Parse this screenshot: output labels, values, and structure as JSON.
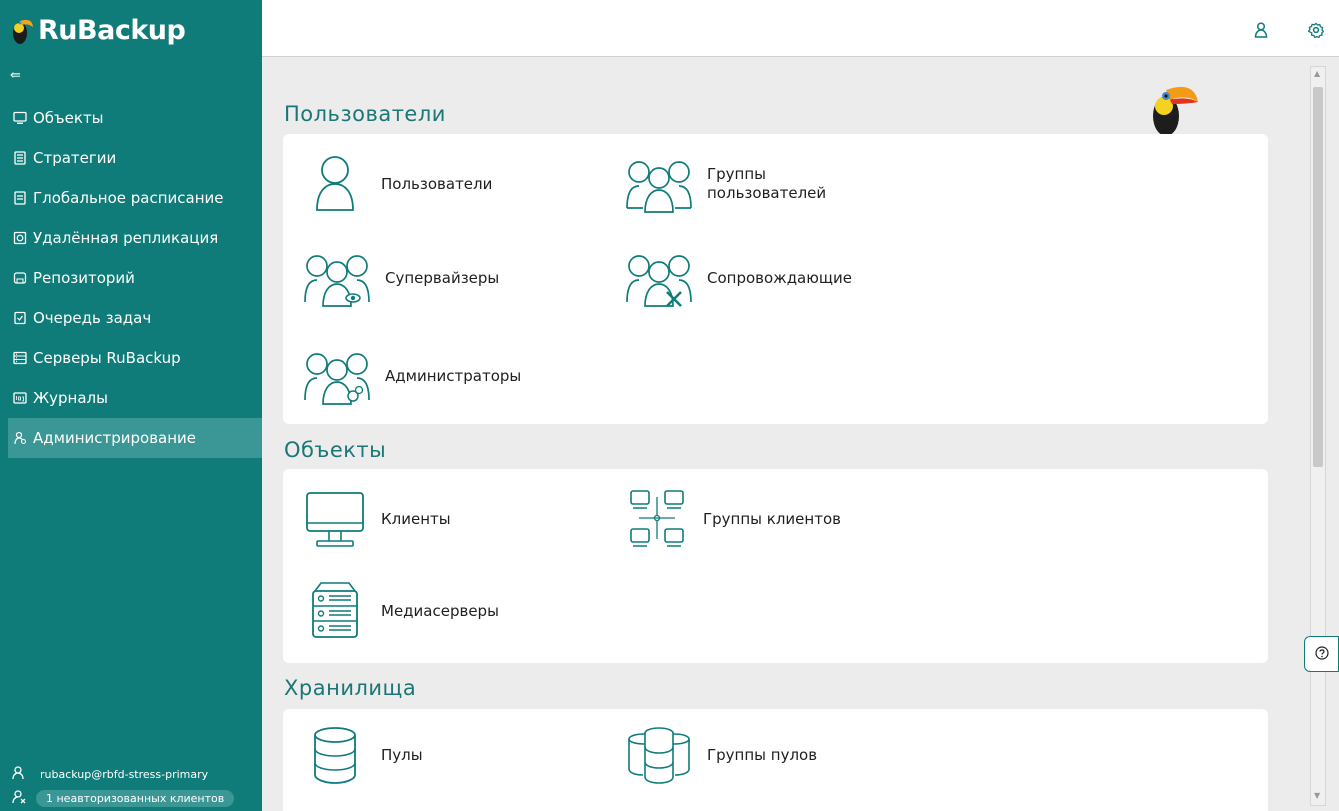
{
  "app": {
    "logo_ru": "Ru",
    "logo_backup": "Backup"
  },
  "sidebar": {
    "collapse_glyph": "⇚",
    "items": [
      {
        "label": "Объекты",
        "icon": "monitor-icon"
      },
      {
        "label": "Стратегии",
        "icon": "strategy-icon"
      },
      {
        "label": "Глобальное расписание",
        "icon": "schedule-icon"
      },
      {
        "label": "Удалённая репликация",
        "icon": "replication-icon"
      },
      {
        "label": "Репозиторий",
        "icon": "repository-icon"
      },
      {
        "label": "Очередь задач",
        "icon": "task-queue-icon"
      },
      {
        "label": "Серверы RuBackup",
        "icon": "servers-icon"
      },
      {
        "label": "Журналы",
        "icon": "log-icon"
      },
      {
        "label": "Администрирование",
        "icon": "admin-icon",
        "active": true
      }
    ],
    "footer": {
      "user": "rubackup@rbfd-stress-primary",
      "unauthorized_clients": "1 неавторизованных клиентов"
    }
  },
  "topbar": {
    "icons": [
      "user-icon",
      "settings-icon"
    ]
  },
  "sections": {
    "users": {
      "title": "Пользователи",
      "tiles": [
        {
          "label": "Пользователи",
          "icon": "user-icon"
        },
        {
          "label_line1": "Группы",
          "label_line2": "пользователей",
          "icon": "user-group-icon"
        },
        {
          "label": "Супервайзеры",
          "icon": "supervisors-icon"
        },
        {
          "label": "Сопровождающие",
          "icon": "maintainers-icon"
        },
        {
          "label": "Администраторы",
          "icon": "administrators-icon"
        }
      ]
    },
    "objects": {
      "title": "Объекты",
      "tiles": [
        {
          "label": "Клиенты",
          "icon": "client-monitor-icon"
        },
        {
          "label": "Группы клиентов",
          "icon": "client-group-icon"
        },
        {
          "label": "Медиасерверы",
          "icon": "media-server-icon"
        }
      ]
    },
    "storage": {
      "title": "Хранилища",
      "tiles": [
        {
          "label": "Пулы",
          "icon": "pool-icon"
        },
        {
          "label": "Группы пулов",
          "icon": "pool-group-icon"
        }
      ]
    }
  },
  "colors": {
    "brand": "#0f7c7a",
    "active_nav": "#3a9795",
    "accent_text": "#1a7775"
  }
}
